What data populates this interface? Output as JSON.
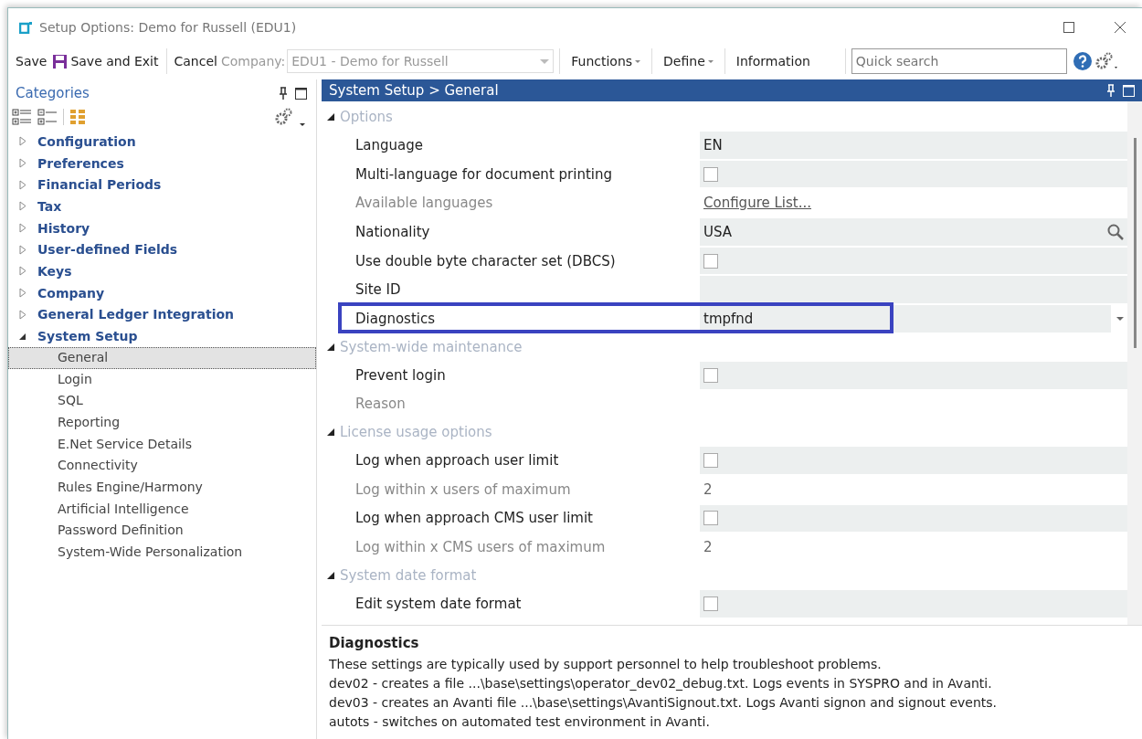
{
  "window": {
    "title": "Setup Options: Demo for Russell (EDU1)"
  },
  "toolbar": {
    "save": "Save",
    "save_and_exit": "Save and Exit",
    "cancel": "Cancel",
    "company_label": "Company:",
    "company_value": "EDU1 - Demo for Russell",
    "menus": [
      {
        "label": "Functions",
        "dropdown": true
      },
      {
        "label": "Define",
        "dropdown": true
      },
      {
        "label": "Information",
        "dropdown": false
      }
    ],
    "search": {
      "placeholder": "Quick search"
    }
  },
  "sidebar": {
    "title": "Categories",
    "items": [
      {
        "label": "Configuration",
        "expanded": false,
        "selected": false
      },
      {
        "label": "Preferences",
        "expanded": false,
        "selected": false
      },
      {
        "label": "Financial Periods",
        "expanded": false,
        "selected": false
      },
      {
        "label": "Tax",
        "expanded": false,
        "selected": false
      },
      {
        "label": "History",
        "expanded": false,
        "selected": false
      },
      {
        "label": "User-defined Fields",
        "expanded": false,
        "selected": false
      },
      {
        "label": "Keys",
        "expanded": false,
        "selected": false
      },
      {
        "label": "Company",
        "expanded": false,
        "selected": false
      },
      {
        "label": "General Ledger Integration",
        "expanded": false,
        "selected": false
      },
      {
        "label": "System Setup",
        "expanded": true,
        "selected": false,
        "children": [
          {
            "label": "General",
            "selected": true
          },
          {
            "label": "Login",
            "selected": false
          },
          {
            "label": "SQL",
            "selected": false
          },
          {
            "label": "Reporting",
            "selected": false
          },
          {
            "label": "E.Net Service Details",
            "selected": false
          },
          {
            "label": "Connectivity",
            "selected": false
          },
          {
            "label": "Rules Engine/Harmony",
            "selected": false
          },
          {
            "label": "Artificial Intelligence",
            "selected": false
          },
          {
            "label": "Password Definition",
            "selected": false
          },
          {
            "label": "System-Wide Personalization",
            "selected": false
          }
        ]
      }
    ]
  },
  "panel": {
    "breadcrumb": "System Setup > General",
    "sections": [
      {
        "title": "Options",
        "expanded": true,
        "rows": [
          {
            "label": "Language",
            "kind": "text",
            "value": "EN",
            "disabled": false,
            "highlighted": false
          },
          {
            "label": "Multi-language for document printing",
            "kind": "checkbox",
            "checked": false,
            "disabled": false,
            "highlighted": false
          },
          {
            "label": "Available languages",
            "kind": "link",
            "value": "Configure List...",
            "disabled": true,
            "highlighted": false
          },
          {
            "label": "Nationality",
            "kind": "lookup",
            "value": "USA",
            "disabled": false,
            "highlighted": false
          },
          {
            "label": "Use double byte character set (DBCS)",
            "kind": "checkbox",
            "checked": false,
            "disabled": false,
            "highlighted": false
          },
          {
            "label": "Site ID",
            "kind": "text",
            "disabled": false,
            "highlighted": false
          },
          {
            "label": "Diagnostics",
            "kind": "dropdown",
            "value": "tmpfnd",
            "disabled": false,
            "highlighted": true
          }
        ]
      },
      {
        "title": "System-wide maintenance",
        "expanded": true,
        "rows": [
          {
            "label": "Prevent login",
            "kind": "checkbox",
            "checked": false,
            "disabled": false,
            "highlighted": false
          },
          {
            "label": "Reason",
            "kind": "blank",
            "disabled": true,
            "highlighted": false
          }
        ]
      },
      {
        "title": "License usage options",
        "expanded": true,
        "rows": [
          {
            "label": "Log when approach user limit",
            "kind": "checkbox",
            "checked": false,
            "disabled": false,
            "highlighted": false
          },
          {
            "label": "Log within x users of maximum",
            "kind": "plain",
            "value": "2",
            "disabled": true,
            "highlighted": false
          },
          {
            "label": "Log when approach CMS user limit",
            "kind": "checkbox",
            "checked": false,
            "disabled": false,
            "highlighted": false
          },
          {
            "label": "Log within x CMS users of maximum",
            "kind": "plain",
            "value": "2",
            "disabled": true,
            "highlighted": false
          }
        ]
      },
      {
        "title": "System date format",
        "expanded": true,
        "rows": [
          {
            "label": "Edit system date format",
            "kind": "checkbox",
            "checked": false,
            "disabled": false,
            "highlighted": false
          }
        ]
      }
    ]
  },
  "help": {
    "title": "Diagnostics",
    "lines": [
      "These settings are typically used by support personnel to help troubleshoot problems.",
      "dev02 - creates a file ...\\base\\settings\\operator_dev02_debug.txt. Logs events in SYSPRO and in Avanti.",
      "dev03 - creates an Avanti file ...\\base\\settings\\AvantiSignout.txt. Logs Avanti signon and signout events.",
      "autots - switches on automated test environment in Avanti."
    ]
  }
}
